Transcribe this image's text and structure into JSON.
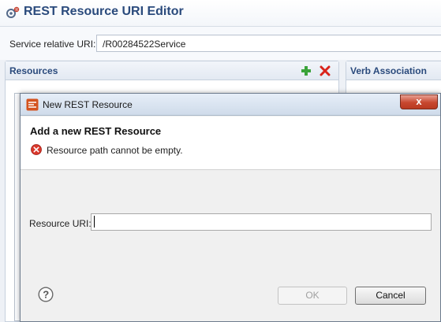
{
  "editor": {
    "title": "REST Resource URI Editor",
    "icon": "rest-resource-icon",
    "service_uri": {
      "label": "Service relative URI:",
      "value": "/R00284522Service"
    },
    "resources_section": {
      "title": "Resources",
      "toolbar": {
        "add_icon": "plus-icon",
        "remove_icon": "red-x-icon"
      }
    },
    "verb_section": {
      "title": "Verb Association"
    }
  },
  "dialog": {
    "title": "New REST Resource",
    "icon": "rest-dialog-icon",
    "close_label": "x",
    "banner": {
      "title": "Add a new REST Resource",
      "error_icon": "error-icon",
      "error_message": "Resource path cannot be empty."
    },
    "resource_uri": {
      "label": "Resource URI:",
      "value": ""
    },
    "help_icon": "help-icon",
    "ok_label": "OK",
    "cancel_label": "Cancel"
  },
  "colors": {
    "title_blue": "#2a4a7c",
    "close_red": "#c7472f",
    "error_red": "#d9372b",
    "add_green": "#3aa33a"
  }
}
